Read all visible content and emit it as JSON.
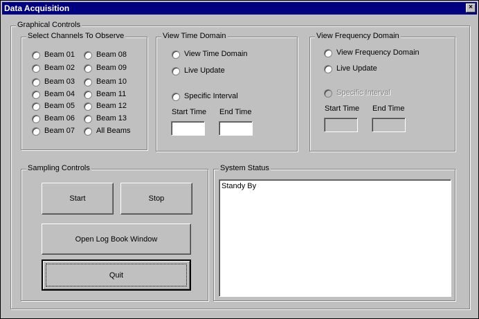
{
  "window": {
    "title": "Data Acquisition",
    "close_glyph": "×"
  },
  "graphical_controls": {
    "label": "Graphical Controls",
    "channels": {
      "label": "Select Channels To Observe",
      "col1": [
        "Beam 01",
        "Beam 02",
        "Beam 03",
        "Beam 04",
        "Beam 05",
        "Beam 06",
        "Beam 07"
      ],
      "col2": [
        "Beam 08",
        "Beam 09",
        "Beam 10",
        "Beam 11",
        "Beam 12",
        "Beam 13",
        "All Beams"
      ]
    },
    "time_domain": {
      "label": "View Time Domain",
      "option_view": "View Time Domain",
      "option_live": "Live Update",
      "option_interval": "Specific Interval",
      "start_label": "Start Time",
      "end_label": "End Time",
      "start_value": "",
      "end_value": ""
    },
    "freq_domain": {
      "label": "View Frequency Domain",
      "option_view": "View Frequency Domain",
      "option_live": "Live Update",
      "option_interval": "Specific Interval",
      "start_label": "Start Time",
      "end_label": "End Time",
      "start_value": "",
      "end_value": ""
    }
  },
  "sampling": {
    "label": "Sampling Controls",
    "start_label": "Start",
    "stop_label": "Stop",
    "log_label": "Open Log Book Window",
    "quit_label": "Quit"
  },
  "status": {
    "label": "System Status",
    "text": "Standy By"
  }
}
